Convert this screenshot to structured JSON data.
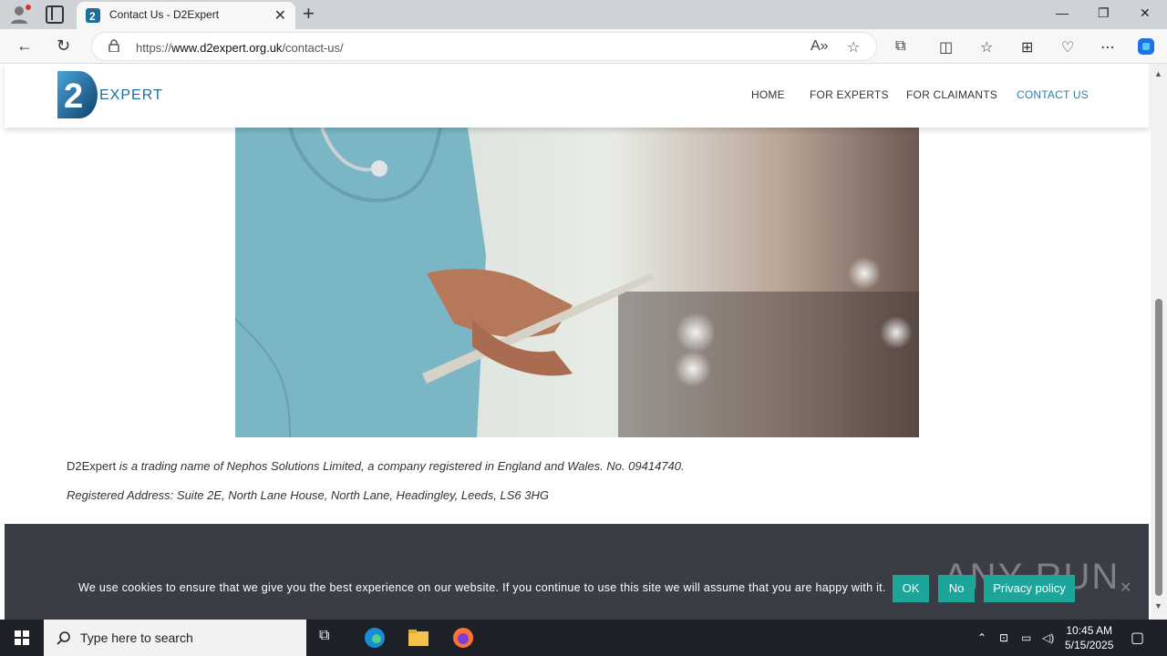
{
  "browser": {
    "tab_title": "Contact Us - D2Expert",
    "url_prefix": "https://",
    "url_domain": "www.d2expert.org.uk",
    "url_path": "/contact-us/"
  },
  "site": {
    "logo_text": "EXPERT",
    "logo_digit": "2",
    "nav": [
      {
        "label": "HOME"
      },
      {
        "label": "FOR EXPERTS"
      },
      {
        "label": "FOR CLAIMANTS"
      },
      {
        "label": "CONTACT US"
      }
    ],
    "legal_brand": "D2Expert",
    "legal_line1": " is a trading name of Nephos Solutions Limited, a company registered in England and Wales. No. 09414740.",
    "legal_line2": "Registered Address: Suite 2E, North Lane House, North Lane, Headingley, Leeds, LS6 3HG"
  },
  "cookie": {
    "text": "We use cookies to ensure that we give you the best experience on our website. If you continue to use this site we will assume that you are happy with it.",
    "ok_label": "OK",
    "no_label": "No",
    "policy_label": "Privacy policy"
  },
  "watermark": "ANY RUN",
  "taskbar": {
    "search_placeholder": "Type here to search",
    "time": "10:45 AM",
    "date": "5/15/2025"
  },
  "colors": {
    "accent": "#2a7ea6",
    "footer": "#3a3d45",
    "cookie_button": "#1ea59a"
  }
}
